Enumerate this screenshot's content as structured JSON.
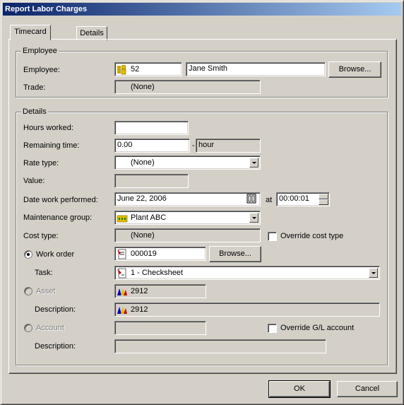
{
  "window": {
    "title": "Report Labor Charges"
  },
  "tabs": [
    {
      "label": "Timecard"
    },
    {
      "label": "Details"
    }
  ],
  "employee_group": {
    "title": "Employee",
    "employee_label": "Employee:",
    "employee_id": "52",
    "employee_name": "Jane Smith",
    "browse_label": "Browse...",
    "trade_label": "Trade:",
    "trade_value": "(None)"
  },
  "details_group": {
    "title": "Details",
    "hours_label": "Hours worked:",
    "hours_value": "",
    "remaining_label": "Remaining time:",
    "remaining_value": "0.00",
    "remaining_sep": "-",
    "remaining_unit": "hour",
    "rate_label": "Rate type:",
    "rate_value": "(None)",
    "value_label": "Value:",
    "value_value": "",
    "date_label": "Date work performed:",
    "date_value": "June 22, 2006",
    "at_label": "at",
    "time_value": "00:00:01",
    "maint_label": "Maintenance group:",
    "maint_value": "Plant ABC",
    "cost_label": "Cost type:",
    "cost_value": "(None)",
    "override_cost_label": "Override cost type",
    "workorder_label": "Work order",
    "workorder_value": "000019",
    "workorder_browse": "Browse...",
    "task_label": "Task:",
    "task_value": "1 - Checksheet",
    "asset_label": "Asset",
    "asset_value": "2912",
    "asset_desc_label": "Description:",
    "asset_desc_value": "2912",
    "account_label": "Account",
    "account_value": "",
    "override_gl_label": "Override G/L account",
    "account_desc_label": "Description:",
    "account_desc_value": ""
  },
  "footer": {
    "ok_label": "OK",
    "cancel_label": "Cancel"
  },
  "colors": {
    "title_start": "#0a246a",
    "title_end": "#a6caf0",
    "face": "#d4d0c8"
  }
}
